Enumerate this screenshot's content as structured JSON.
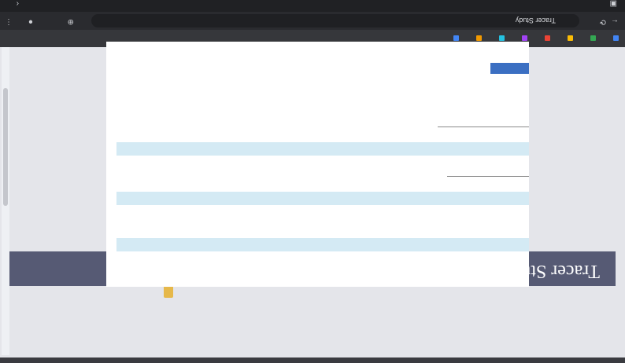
{
  "browser": {
    "window_title": "",
    "tab_title": "Tracer Study",
    "url": "",
    "bookmarks": [
      {
        "label": "",
        "color": "#4285f4"
      },
      {
        "label": "",
        "color": "#34a853"
      },
      {
        "label": "",
        "color": "#fbbc05"
      },
      {
        "label": "",
        "color": "#ea4335"
      },
      {
        "label": "",
        "color": "#a142f4"
      },
      {
        "label": "",
        "color": "#24c1e0"
      },
      {
        "label": "",
        "color": "#f29900"
      },
      {
        "label": "",
        "color": "#4285f4"
      }
    ]
  },
  "page": {
    "banner_title": "Tracer Study",
    "nav_links": [
      "",
      "",
      "",
      ""
    ],
    "fields": [
      {
        "label": ""
      },
      {
        "label": ""
      },
      {
        "label": ""
      }
    ],
    "submit_label": ""
  },
  "colors": {
    "banner": "#565a74",
    "input_fill": "#d4eaf4",
    "button": "#3b6fc2",
    "link": "#4a64b0"
  }
}
